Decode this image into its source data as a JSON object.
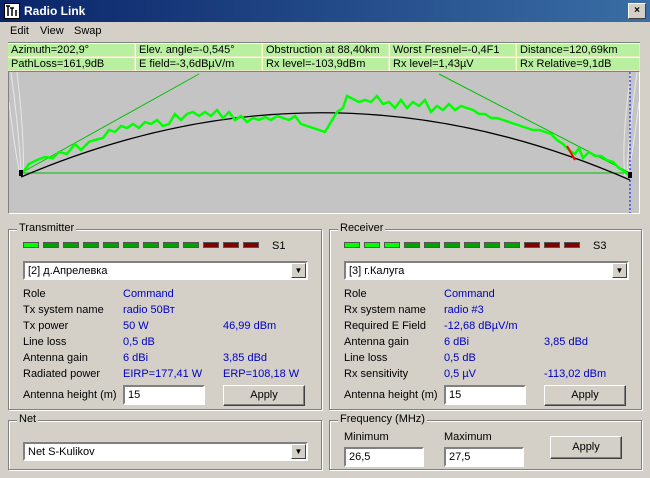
{
  "window": {
    "title": "Radio Link",
    "close_glyph": "×"
  },
  "menu": [
    "Edit",
    "View",
    "Swap"
  ],
  "info": {
    "azimuth": "Azimuth=202,9°",
    "elev": "Elev. angle=-0,545°",
    "obstruction": "Obstruction at 88,40km",
    "fresnel": "Worst Fresnel=-0,4F1",
    "distance": "Distance=120,69km",
    "pathloss": "PathLoss=161,9dB",
    "efield": "E field=-3,6dBµV/m",
    "rxlevel_dbm": "Rx level=-103,9dBm",
    "rxlevel_uv": "Rx level=1,43µV",
    "rxrel": "Rx Relative=9,1dB"
  },
  "profile_colors": {
    "terrain": "#00ff00",
    "earth_curve": "#000000",
    "los": "#00c000",
    "obstruction": "#ff0000"
  },
  "transmitter": {
    "title": "Transmitter",
    "led_label": "S1",
    "leds": [
      "#00ff00",
      "#00a000",
      "#00a000",
      "#00a000",
      "#00a000",
      "#00a000",
      "#00a000",
      "#00a000",
      "#00a000",
      "#800000",
      "#800000",
      "#800000"
    ],
    "site": "[2] д.Апрелевка",
    "rows": [
      {
        "label": "Role",
        "v1": "Command",
        "v2": ""
      },
      {
        "label": "Tx system name",
        "v1": "radio 50Вт",
        "v2": ""
      },
      {
        "label": "Tx power",
        "v1": "50 W",
        "v2": "46,99 dBm"
      },
      {
        "label": "Line loss",
        "v1": "0,5 dB",
        "v2": ""
      },
      {
        "label": "Antenna gain",
        "v1": "6 dBi",
        "v2": "3,85 dBd"
      },
      {
        "label": "Radiated power",
        "v1": "EIRP=177,41 W",
        "v2": "ERP=108,18 W"
      }
    ],
    "height_label": "Antenna height (m)",
    "height": "15",
    "apply": "Apply"
  },
  "receiver": {
    "title": "Receiver",
    "led_label": "S3",
    "leds": [
      "#00ff00",
      "#00ff00",
      "#00ff00",
      "#00a000",
      "#00a000",
      "#00a000",
      "#00a000",
      "#00a000",
      "#00a000",
      "#800000",
      "#800000",
      "#800000"
    ],
    "site": "[3] г.Калуга",
    "rows": [
      {
        "label": "Role",
        "v1": "Command",
        "v2": ""
      },
      {
        "label": "Rx system name",
        "v1": "radio #3",
        "v2": ""
      },
      {
        "label": "Required E Field",
        "v1": "-12,68 dBµV/m",
        "v2": ""
      },
      {
        "label": "Antenna gain",
        "v1": "6 dBi",
        "v2": "3,85 dBd"
      },
      {
        "label": "Line loss",
        "v1": "0,5 dB",
        "v2": ""
      },
      {
        "label": "Rx sensitivity",
        "v1": "0,5 µV",
        "v2": "-113,02 dBm"
      }
    ],
    "height_label": "Antenna height (m)",
    "height": "15",
    "apply": "Apply"
  },
  "net": {
    "title": "Net",
    "value": "Net  S-Kulikov"
  },
  "frequency": {
    "title": "Frequency (MHz)",
    "min_label": "Minimum",
    "min": "26,5",
    "max_label": "Maximum",
    "max": "27,5",
    "apply": "Apply"
  }
}
